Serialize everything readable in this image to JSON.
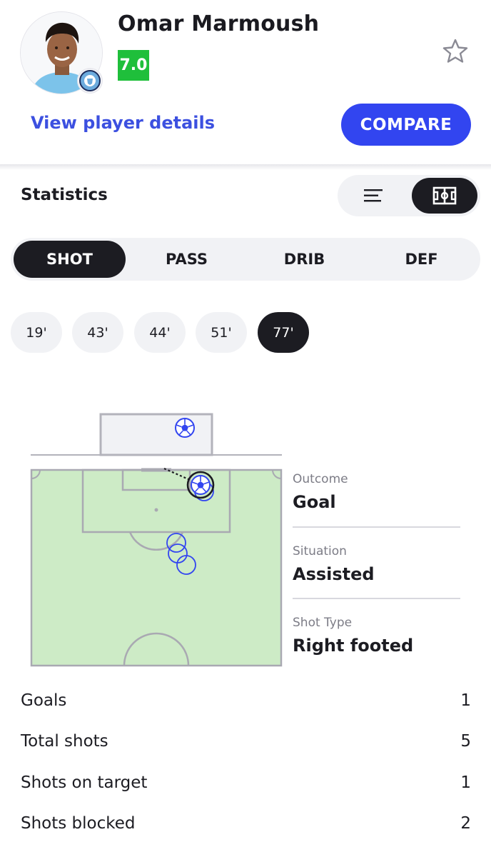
{
  "player": {
    "name": "Omar Marmoush",
    "rating": "7.0",
    "details_link": "View player details",
    "compare_label": "COMPARE"
  },
  "colors": {
    "accent": "#3245f0",
    "rating_bg": "#1fbf3b",
    "pitch": "#cdebc6",
    "dark": "#1c1c22"
  },
  "statistics": {
    "title": "Statistics",
    "view_options": [
      "list-icon",
      "pitch-icon"
    ],
    "selected_view": "pitch"
  },
  "category_tabs": [
    {
      "label": "SHOT",
      "active": true
    },
    {
      "label": "PASS",
      "active": false
    },
    {
      "label": "DRIB",
      "active": false
    },
    {
      "label": "DEF",
      "active": false
    }
  ],
  "minute_chips": [
    {
      "label": "19'",
      "active": false
    },
    {
      "label": "43'",
      "active": false
    },
    {
      "label": "44'",
      "active": false
    },
    {
      "label": "51'",
      "active": false
    },
    {
      "label": "77'",
      "active": true
    }
  ],
  "shot_details": [
    {
      "label": "Outcome",
      "value": "Goal"
    },
    {
      "label": "Situation",
      "value": "Assisted"
    },
    {
      "label": "Shot Type",
      "value": "Right footed"
    }
  ],
  "stats": [
    {
      "label": "Goals",
      "value": "1"
    },
    {
      "label": "Total shots",
      "value": "5"
    },
    {
      "label": "Shots on target",
      "value": "1"
    },
    {
      "label": "Shots blocked",
      "value": "2"
    }
  ]
}
